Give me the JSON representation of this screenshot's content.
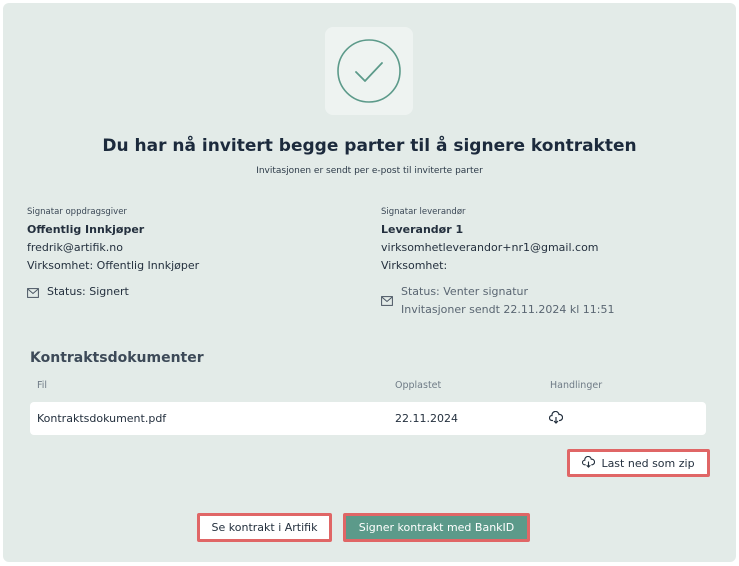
{
  "header": {
    "title": "Du har nå invitert begge parter til å signere kontrakten",
    "subtitle": "Invitasjonen er sendt per e-post til inviterte parter"
  },
  "client": {
    "label": "Signatar oppdragsgiver",
    "name": "Offentlig Innkjøper",
    "email": "fredrik@artifik.no",
    "company": "Virksomhet: Offentlig Innkjøper",
    "status": "Status: Signert"
  },
  "supplier": {
    "label": "Signatar leverandør",
    "name": "Leverandør 1",
    "email": "virksomhetleverandor+nr1@gmail.com",
    "company": "Virksomhet:",
    "status": "Status: Venter signatur",
    "invited": "Invitasjoner sendt 22.11.2024 kl 11:51"
  },
  "documents": {
    "heading": "Kontraktsdokumenter",
    "columns": [
      "Fil",
      "Opplastet",
      "Handlinger"
    ],
    "rows": [
      {
        "file": "Kontraktsdokument.pdf",
        "uploaded": "22.11.2024",
        "action_icon": "cloud-download-icon"
      }
    ],
    "zip_label": "Last ned som zip"
  },
  "footer": {
    "see_label": "Se kontrakt i Artifik",
    "sign_label": "Signer kontrakt med BankID"
  },
  "colors": {
    "panel": "#e3ebe8",
    "accent": "#5c9a8a",
    "highlight": "#e06666"
  }
}
